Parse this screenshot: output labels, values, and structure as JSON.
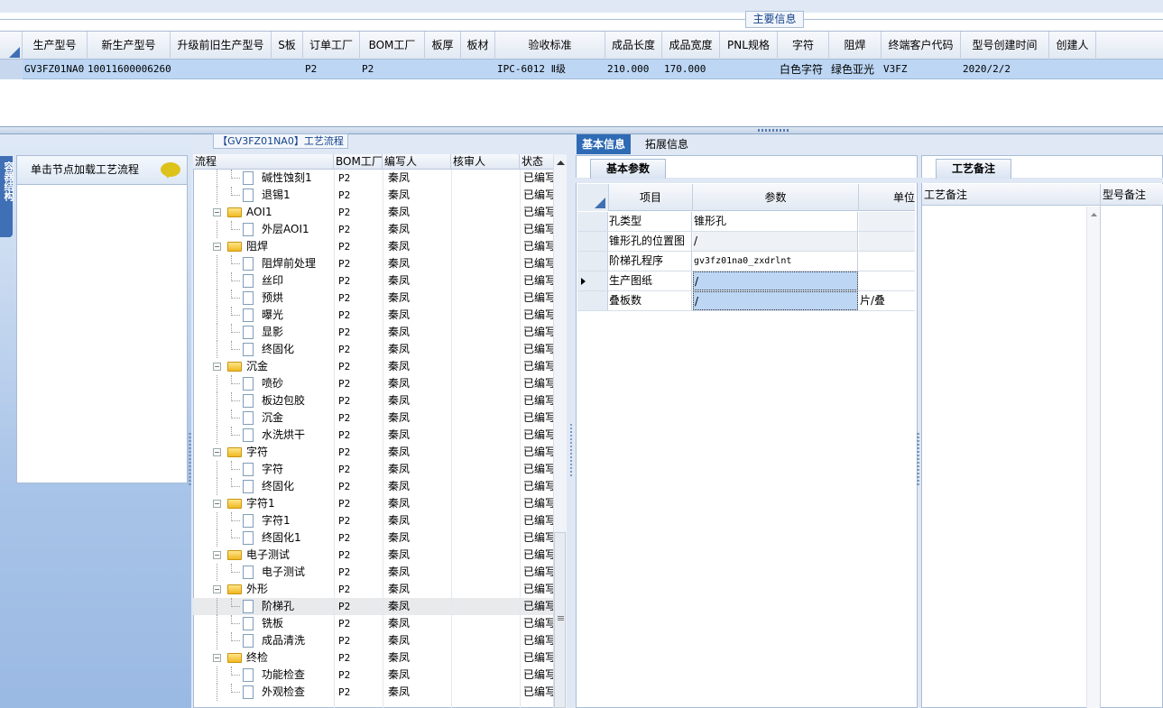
{
  "main_info": {
    "group_title": "主要信息",
    "columns": [
      "生产型号",
      "新生产型号",
      "升级前旧生产型号",
      "S板",
      "订单工厂",
      "BOM工厂",
      "板厚",
      "板材",
      "验收标准",
      "成品长度",
      "成品宽度",
      "PNL规格",
      "字符",
      "阻焊",
      "终端客户代码",
      "型号创建时间",
      "创建人"
    ],
    "row": {
      "model": "GV3FZ01NA0",
      "new_model": "10011600006260",
      "old_model": "",
      "s_board": "",
      "order_factory": "P2",
      "bom_factory": "P2",
      "thickness": "",
      "material": "",
      "standard": "IPC-6012 Ⅱ级",
      "length": "210.000",
      "width": "170.000",
      "pnl": "",
      "character": "白色字符",
      "solder_mask": "绿色亚光",
      "customer_code": "V3FZ",
      "created": "2020/2/2",
      "creator": ""
    }
  },
  "left_panel": {
    "side_tab": "容器结构",
    "hint": "单击节点加载工艺流程"
  },
  "process_tree": {
    "title": "【GV3FZ01NA0】工艺流程",
    "columns": [
      "流程",
      "BOM工厂",
      "编写人",
      "核审人",
      "状态"
    ],
    "rows": [
      {
        "label": "碱性蚀刻1",
        "type": "doc",
        "factory": "P2",
        "editor": "秦凤",
        "reviewer": "",
        "status": "已编写"
      },
      {
        "label": "退锡1",
        "type": "doc",
        "factory": "P2",
        "editor": "秦凤",
        "reviewer": "",
        "status": "已编写"
      },
      {
        "label": "AOI1",
        "type": "folder",
        "factory": "P2",
        "editor": "秦凤",
        "reviewer": "",
        "status": "已编写"
      },
      {
        "label": "外层AOI1",
        "type": "doc",
        "factory": "P2",
        "editor": "秦凤",
        "reviewer": "",
        "status": "已编写"
      },
      {
        "label": "阻焊",
        "type": "folder",
        "factory": "P2",
        "editor": "秦凤",
        "reviewer": "",
        "status": "已编写"
      },
      {
        "label": "阻焊前处理",
        "type": "doc",
        "factory": "P2",
        "editor": "秦凤",
        "reviewer": "",
        "status": "已编写"
      },
      {
        "label": "丝印",
        "type": "doc",
        "factory": "P2",
        "editor": "秦凤",
        "reviewer": "",
        "status": "已编写"
      },
      {
        "label": "预烘",
        "type": "doc",
        "factory": "P2",
        "editor": "秦凤",
        "reviewer": "",
        "status": "已编写"
      },
      {
        "label": "曝光",
        "type": "doc",
        "factory": "P2",
        "editor": "秦凤",
        "reviewer": "",
        "status": "已编写"
      },
      {
        "label": "显影",
        "type": "doc",
        "factory": "P2",
        "editor": "秦凤",
        "reviewer": "",
        "status": "已编写"
      },
      {
        "label": "终固化",
        "type": "doc",
        "factory": "P2",
        "editor": "秦凤",
        "reviewer": "",
        "status": "已编写"
      },
      {
        "label": "沉金",
        "type": "folder",
        "factory": "P2",
        "editor": "秦凤",
        "reviewer": "",
        "status": "已编写"
      },
      {
        "label": "喷砂",
        "type": "doc",
        "factory": "P2",
        "editor": "秦凤",
        "reviewer": "",
        "status": "已编写"
      },
      {
        "label": "板边包胶",
        "type": "doc",
        "factory": "P2",
        "editor": "秦凤",
        "reviewer": "",
        "status": "已编写"
      },
      {
        "label": "沉金",
        "type": "doc",
        "factory": "P2",
        "editor": "秦凤",
        "reviewer": "",
        "status": "已编写"
      },
      {
        "label": "水洗烘干",
        "type": "doc",
        "factory": "P2",
        "editor": "秦凤",
        "reviewer": "",
        "status": "已编写"
      },
      {
        "label": "字符",
        "type": "folder",
        "factory": "P2",
        "editor": "秦凤",
        "reviewer": "",
        "status": "已编写"
      },
      {
        "label": "字符",
        "type": "doc",
        "factory": "P2",
        "editor": "秦凤",
        "reviewer": "",
        "status": "已编写"
      },
      {
        "label": "终固化",
        "type": "doc",
        "factory": "P2",
        "editor": "秦凤",
        "reviewer": "",
        "status": "已编写"
      },
      {
        "label": "字符1",
        "type": "folder",
        "factory": "P2",
        "editor": "秦凤",
        "reviewer": "",
        "status": "已编写"
      },
      {
        "label": "字符1",
        "type": "doc",
        "factory": "P2",
        "editor": "秦凤",
        "reviewer": "",
        "status": "已编写"
      },
      {
        "label": "终固化1",
        "type": "doc",
        "factory": "P2",
        "editor": "秦凤",
        "reviewer": "",
        "status": "已编写"
      },
      {
        "label": "电子测试",
        "type": "folder",
        "factory": "P2",
        "editor": "秦凤",
        "reviewer": "",
        "status": "已编写"
      },
      {
        "label": "电子测试",
        "type": "doc",
        "factory": "P2",
        "editor": "秦凤",
        "reviewer": "",
        "status": "已编写"
      },
      {
        "label": "外形",
        "type": "folder",
        "factory": "P2",
        "editor": "秦凤",
        "reviewer": "",
        "status": "已编写"
      },
      {
        "label": "阶梯孔",
        "type": "doc",
        "factory": "P2",
        "editor": "秦凤",
        "reviewer": "",
        "status": "已编写",
        "selected": true
      },
      {
        "label": "铣板",
        "type": "doc",
        "factory": "P2",
        "editor": "秦凤",
        "reviewer": "",
        "status": "已编写"
      },
      {
        "label": "成品清洗",
        "type": "doc",
        "factory": "P2",
        "editor": "秦凤",
        "reviewer": "",
        "status": "已编写"
      },
      {
        "label": "终检",
        "type": "folder",
        "factory": "P2",
        "editor": "秦凤",
        "reviewer": "",
        "status": "已编写"
      },
      {
        "label": "功能检查",
        "type": "doc",
        "factory": "P2",
        "editor": "秦凤",
        "reviewer": "",
        "status": "已编写"
      },
      {
        "label": "外观检查",
        "type": "doc",
        "factory": "P2",
        "editor": "秦凤",
        "reviewer": "",
        "status": "已编写"
      }
    ]
  },
  "right_tabs": [
    "基本信息",
    "拓展信息"
  ],
  "basic_params": {
    "tab": "基本参数",
    "columns": [
      "项目",
      "参数",
      "单位"
    ],
    "rows": [
      {
        "item": "孔类型",
        "value": "锥形孔",
        "unit": ""
      },
      {
        "item": "锥形孔的位置图",
        "value": "/",
        "unit": ""
      },
      {
        "item": "阶梯孔程序",
        "value": "gv3fz01na0_zxdrlnt",
        "unit": ""
      },
      {
        "item": "生产图纸",
        "value": "/",
        "unit": ""
      },
      {
        "item": "叠板数",
        "value": "/",
        "unit": "片/叠"
      }
    ]
  },
  "craft_notes": {
    "tab": "工艺备注",
    "columns": [
      "工艺备注",
      "型号备注"
    ]
  },
  "colors": {
    "accent": "#2f6ab4",
    "selection": "#bcd6f4",
    "frame": "#dfe8f4"
  }
}
